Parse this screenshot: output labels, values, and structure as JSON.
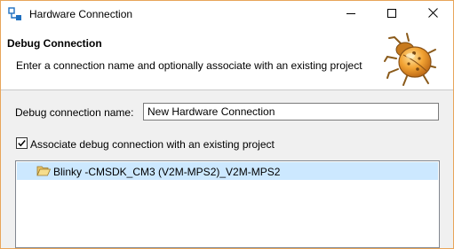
{
  "window": {
    "title": "Hardware Connection",
    "accent": "#e8a55a"
  },
  "titlebar": {
    "icons": [
      "app-icon",
      "minimize-icon",
      "maximize-icon",
      "close-icon"
    ]
  },
  "header": {
    "title": "Debug Connection",
    "description": "Enter a connection name and optionally associate with an existing project",
    "icon": "bug-icon"
  },
  "form": {
    "name_label": "Debug connection name:",
    "name_value": "New Hardware Connection",
    "associate_label": "Associate debug connection with an existing project",
    "associate_checked": true
  },
  "projects": {
    "items": [
      {
        "label": "Blinky -CMSDK_CM3 (V2M-MPS2)_V2M-MPS2",
        "selected": true,
        "icon": "open-folder-icon"
      }
    ],
    "selection_color": "#cce8ff"
  }
}
